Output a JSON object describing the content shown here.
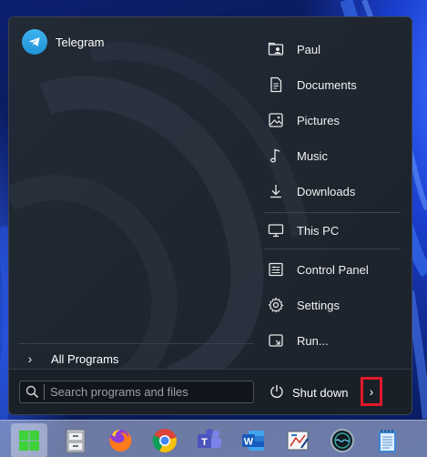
{
  "colors": {
    "menu_bg": "#1f2630",
    "accent_red": "#e0192a",
    "telegram_blue": "#2aa3e3",
    "start_green": "#3dd13a"
  },
  "start_menu": {
    "pinned": [
      {
        "label": "Telegram",
        "icon": "telegram-icon"
      }
    ],
    "all_programs_label": "All Programs",
    "right_items": [
      {
        "label": "Paul",
        "icon": "user-folder-icon"
      },
      {
        "label": "Documents",
        "icon": "document-icon"
      },
      {
        "label": "Pictures",
        "icon": "picture-icon"
      },
      {
        "label": "Music",
        "icon": "music-note-icon"
      },
      {
        "label": "Downloads",
        "icon": "download-icon"
      },
      {
        "label": "This PC",
        "icon": "monitor-icon"
      },
      {
        "label": "Control Panel",
        "icon": "control-panel-icon"
      },
      {
        "label": "Settings",
        "icon": "gear-icon"
      },
      {
        "label": "Run...",
        "icon": "run-icon"
      }
    ],
    "search": {
      "placeholder": "Search programs and files",
      "value": ""
    },
    "shutdown_label": "Shut down",
    "shutdown_arrow_icon": "chevron-right-icon"
  },
  "taskbar": {
    "items": [
      {
        "name": "start-button",
        "icon": "windows-logo-icon",
        "active": true
      },
      {
        "name": "file-explorer",
        "icon": "file-cabinet-icon"
      },
      {
        "name": "firefox",
        "icon": "firefox-icon"
      },
      {
        "name": "chrome",
        "icon": "chrome-icon"
      },
      {
        "name": "teams",
        "icon": "teams-icon",
        "letter": "T"
      },
      {
        "name": "word",
        "icon": "word-icon",
        "letter": "W"
      },
      {
        "name": "paint",
        "icon": "paint-icon"
      },
      {
        "name": "circle-app",
        "icon": "circle-app-icon"
      },
      {
        "name": "notepad",
        "icon": "notepad-icon"
      }
    ]
  }
}
